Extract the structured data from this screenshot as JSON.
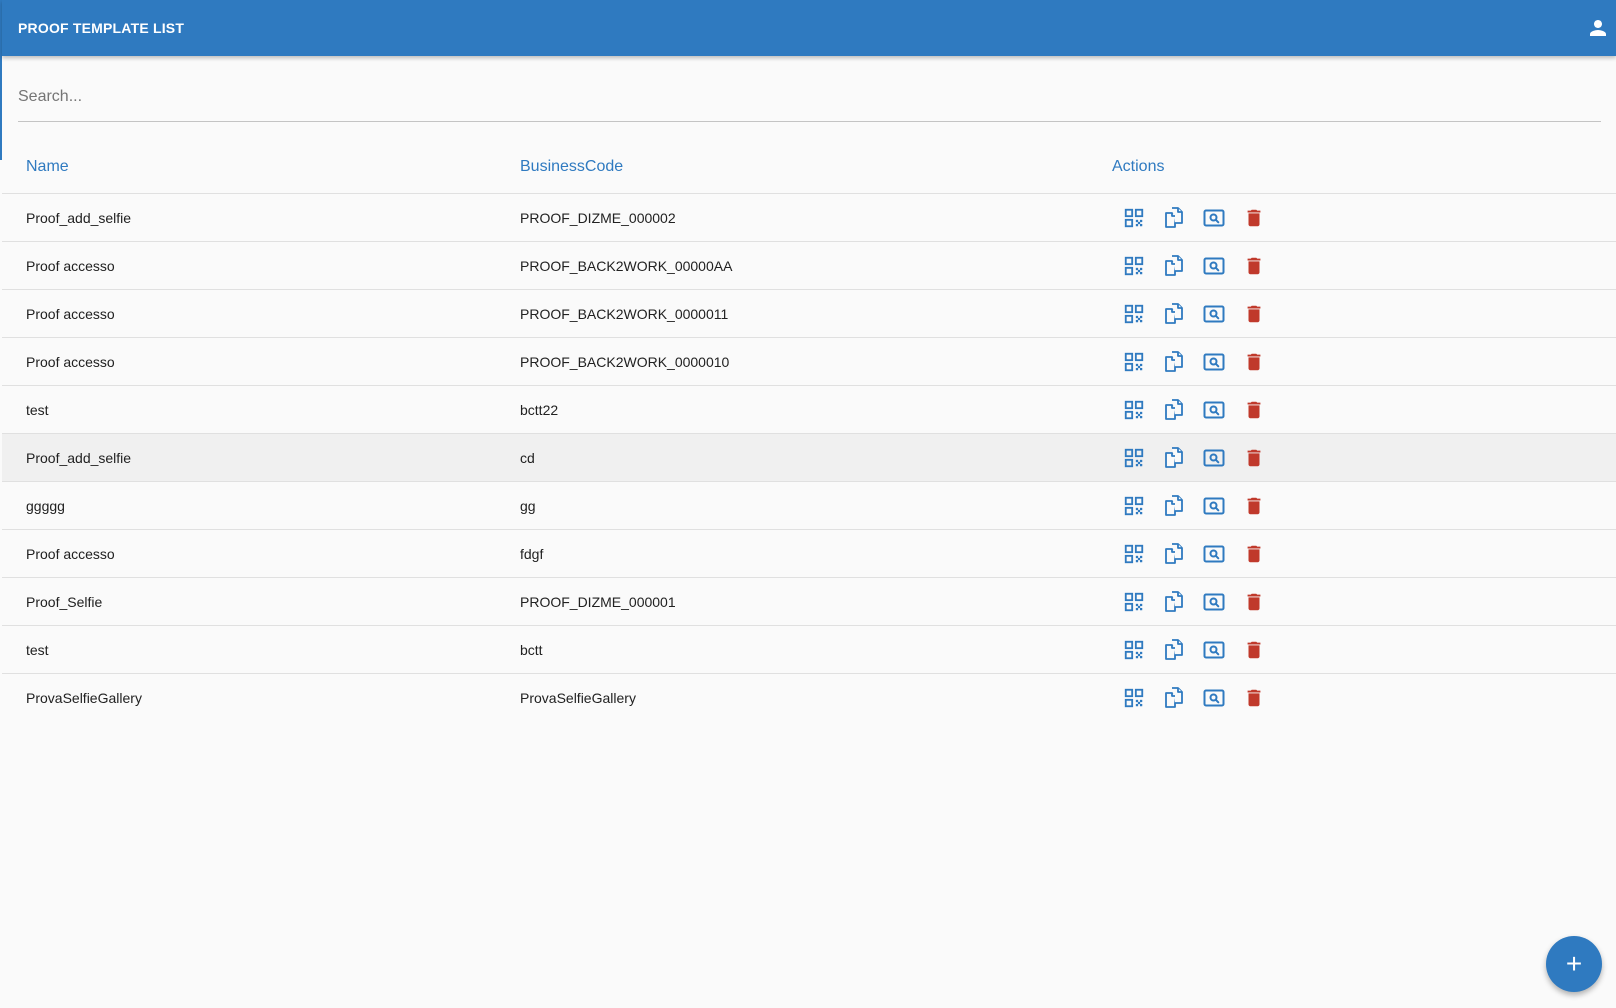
{
  "header": {
    "title": "PROOF TEMPLATE LIST",
    "user_icon": "person-icon"
  },
  "search": {
    "placeholder": "Search...",
    "value": ""
  },
  "table": {
    "columns": [
      "Name",
      "BusinessCode",
      "Actions"
    ],
    "rows": [
      {
        "name": "Proof_add_selfie",
        "code": "PROOF_DIZME_000002"
      },
      {
        "name": "Proof accesso",
        "code": "PROOF_BACK2WORK_00000AA"
      },
      {
        "name": "Proof accesso",
        "code": "PROOF_BACK2WORK_0000011"
      },
      {
        "name": "Proof accesso",
        "code": "PROOF_BACK2WORK_0000010"
      },
      {
        "name": "test",
        "code": "bctt22"
      },
      {
        "name": "Proof_add_selfie",
        "code": "cd"
      },
      {
        "name": "ggggg",
        "code": "gg"
      },
      {
        "name": "Proof accesso",
        "code": "fdgf"
      },
      {
        "name": "Proof_Selfie",
        "code": "PROOF_DIZME_000001"
      },
      {
        "name": "test",
        "code": "bctt"
      },
      {
        "name": "ProvaSelfieGallery",
        "code": "ProvaSelfieGallery"
      }
    ],
    "highlighted_row": 5,
    "action_icons": [
      "qr-code-icon",
      "copy-icon",
      "preview-icon",
      "delete-icon"
    ]
  },
  "fab": {
    "label": "+",
    "icon": "add-icon"
  },
  "colors": {
    "primary": "#2f7ac0",
    "danger": "#c0392b",
    "background": "#fafafa"
  }
}
